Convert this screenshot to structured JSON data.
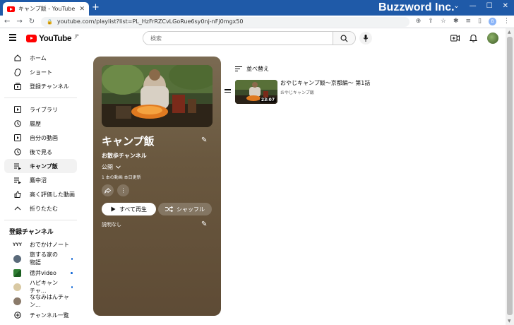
{
  "browser": {
    "tab_title": "キャンプ飯 - YouTube",
    "url": "youtube.com/playlist?list=PL_HzFrRZCvLGoRue6sy0nj-nFj0mgx50",
    "brand": "Buzzword Inc.",
    "profile_initial": "B"
  },
  "header": {
    "logo_text": "YouTube",
    "region": "JP",
    "search_placeholder": "検索"
  },
  "sidebar": {
    "main": [
      {
        "label": "ホーム",
        "icon": "home-icon"
      },
      {
        "label": "ショート",
        "icon": "shorts-icon"
      },
      {
        "label": "登録チャンネル",
        "icon": "subscriptions-icon"
      }
    ],
    "library": [
      {
        "label": "ライブラリ",
        "icon": "library-icon"
      },
      {
        "label": "履歴",
        "icon": "history-icon"
      },
      {
        "label": "自分の動画",
        "icon": "your-videos-icon"
      },
      {
        "label": "後で見る",
        "icon": "watch-later-icon"
      },
      {
        "label": "キャンプ飯",
        "icon": "playlist-icon",
        "active": true
      },
      {
        "label": "鷹中沼",
        "icon": "playlist-icon"
      },
      {
        "label": "高く評価した動画",
        "icon": "like-icon"
      },
      {
        "label": "折りたたむ",
        "icon": "chevron-up-icon"
      }
    ],
    "subscriptions_title": "登録チャンネル",
    "subscriptions": [
      {
        "label": "おでかけノート",
        "new": false
      },
      {
        "label": "旅する家の物語",
        "new": true
      },
      {
        "label": "徳井video",
        "new": true
      },
      {
        "label": "ハピキャンチャ...",
        "new": true
      },
      {
        "label": "ななみはんチャン...",
        "new": false
      }
    ],
    "all_channels": "チャンネル一覧"
  },
  "playlist": {
    "title": "キャンプ飯",
    "owner": "お散歩チャンネル",
    "visibility": "公開",
    "stats": "1 本の動画  本日更新",
    "play_all": "すべて再生",
    "shuffle": "シャッフル",
    "description": "説明なし"
  },
  "list": {
    "sort_label": "並べ替え",
    "videos": [
      {
        "title": "おやじキャンプ飯〜京都編〜 第1話",
        "channel": "おやじキャンプ飯",
        "duration": "23:07"
      }
    ]
  }
}
